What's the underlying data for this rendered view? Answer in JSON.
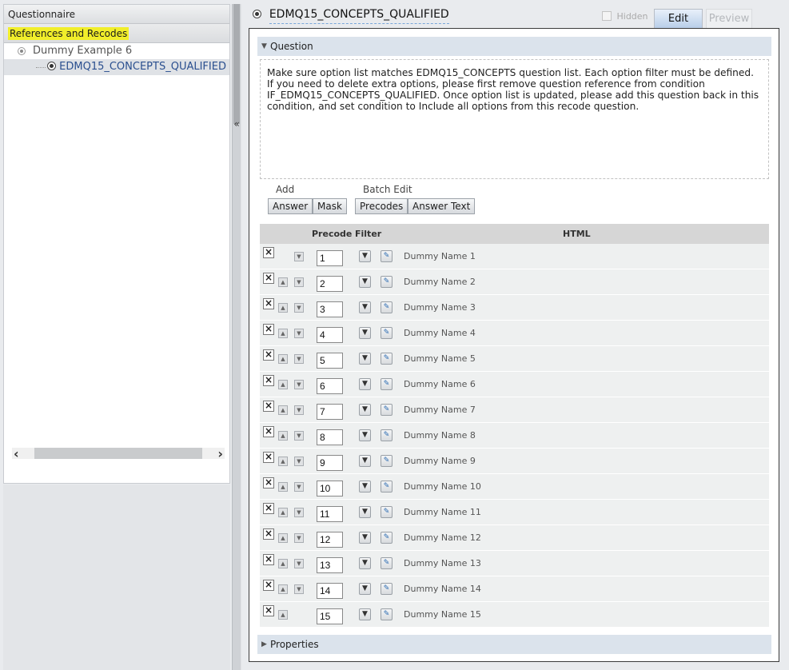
{
  "left_panel": {
    "questionnaire_label": "Questionnaire",
    "references_label": "References and Recodes",
    "tree": {
      "parent_label": "Dummy Example 6",
      "child_label": "EDMQ15_CONCEPTS_QUALIFIED"
    }
  },
  "splitter": {
    "collapse_label": "«"
  },
  "editor": {
    "title": "EDMQ15_CONCEPTS_QUALIFIED",
    "hidden_label": "Hidden",
    "tabs": {
      "edit": "Edit",
      "preview": "Preview"
    },
    "question_section_label": "Question",
    "question_text": "Make sure option list matches EDMQ15_CONCEPTS question list. Each option filter must be defined. If you need to delete extra options, please first remove question reference from condition IF_EDMQ15_CONCEPTS_QUALIFIED. Once option list is updated, please add this question back in this condition, and set condition to Include all options from this recode question.",
    "add_label": "Add",
    "batch_edit_label": "Batch Edit",
    "buttons": {
      "answer": "Answer",
      "mask": "Mask",
      "precodes": "Precodes",
      "answer_text": "Answer Text"
    },
    "grid": {
      "headers": {
        "precode": "Precode",
        "filter": "Filter",
        "html": "HTML"
      },
      "rows": [
        {
          "precode": "1",
          "name": "Dummy Name 1"
        },
        {
          "precode": "2",
          "name": "Dummy Name 2"
        },
        {
          "precode": "3",
          "name": "Dummy Name 3"
        },
        {
          "precode": "4",
          "name": "Dummy Name 4"
        },
        {
          "precode": "5",
          "name": "Dummy Name 5"
        },
        {
          "precode": "6",
          "name": "Dummy Name 6"
        },
        {
          "precode": "7",
          "name": "Dummy Name 7"
        },
        {
          "precode": "8",
          "name": "Dummy Name 8"
        },
        {
          "precode": "9",
          "name": "Dummy Name 9"
        },
        {
          "precode": "10",
          "name": "Dummy Name 10"
        },
        {
          "precode": "11",
          "name": "Dummy Name 11"
        },
        {
          "precode": "12",
          "name": "Dummy Name 12"
        },
        {
          "precode": "13",
          "name": "Dummy Name 13"
        },
        {
          "precode": "14",
          "name": "Dummy Name 14"
        },
        {
          "precode": "15",
          "name": "Dummy Name 15"
        }
      ]
    },
    "properties_section_label": "Properties"
  },
  "icons": {
    "delete": "close-icon",
    "move_up": "arrow-up-icon",
    "move_down": "arrow-down-icon",
    "filter": "filter-icon",
    "edit": "pencil-edit-icon"
  },
  "colors": {
    "highlight": "#f1ee2a",
    "tab_active": "#b7cde8",
    "section_header": "#dbe3ec"
  }
}
